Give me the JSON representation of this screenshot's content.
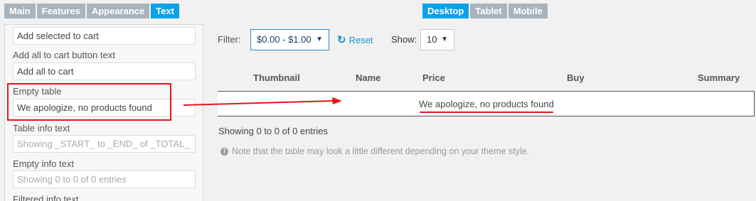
{
  "main_tabs": [
    "Main",
    "Features",
    "Appearance",
    "Text"
  ],
  "device_tabs": [
    "Desktop",
    "Tablet",
    "Mobile"
  ],
  "settings": {
    "add_selected_value": "Add selected to cart",
    "add_all_label": "Add all to cart button text",
    "add_all_value": "Add all to cart",
    "empty_table_label": "Empty table",
    "empty_table_value": "We apologize, no products found",
    "table_info_label": "Table info text",
    "table_info_placeholder": "Showing _START_ to _END_ of _TOTAL_",
    "empty_info_label": "Empty info text",
    "empty_info_placeholder": "Showing 0 to 0 of 0 entries",
    "filtered_info_label": "Filtered info text"
  },
  "preview": {
    "filter_label": "Filter:",
    "filter_value": "$0.00 - $1.00",
    "reset_label": "Reset",
    "show_label": "Show:",
    "show_value": "10",
    "columns": [
      "Thumbnail",
      "Name",
      "Price",
      "Buy",
      "Summary"
    ],
    "empty_message": "We apologize, no products found",
    "info_text": "Showing 0 to 0 of 0 entries",
    "note": "Note that the table may look a little different depending on your theme style."
  },
  "colors": {
    "accent": "#0aa2e8",
    "tab_inactive": "#a8b3bd",
    "highlight": "#e3151d",
    "link": "#1c8fd3"
  }
}
